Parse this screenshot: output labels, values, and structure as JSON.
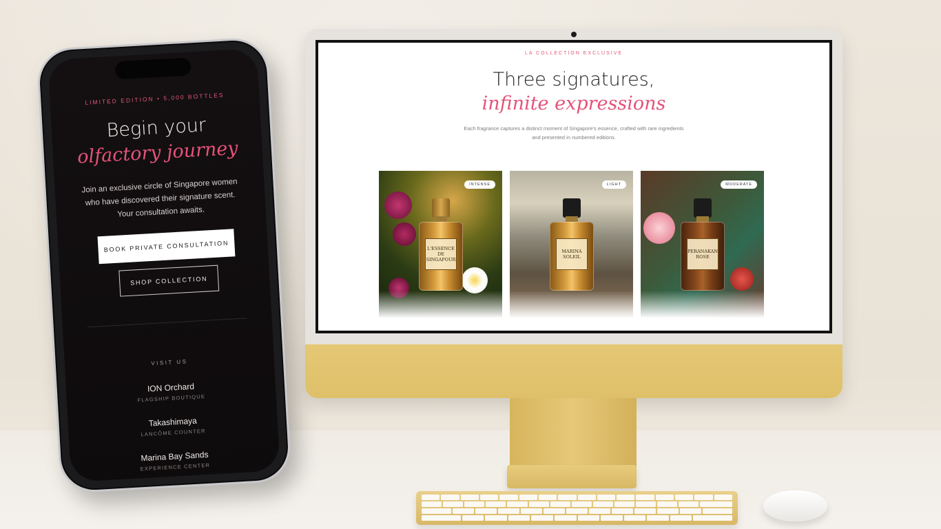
{
  "phone": {
    "eyebrow": "LIMITED EDITION • 5,000 BOTTLES",
    "title_line1": "Begin your",
    "title_line2": "olfactory journey",
    "body": "Join an exclusive circle of Singapore women who have discovered their signature scent. Your consultation awaits.",
    "primary_button": "BOOK PRIVATE CONSULTATION",
    "secondary_button": "SHOP COLLECTION",
    "visit_heading": "VISIT US",
    "locations": [
      {
        "name": "ION Orchard",
        "sub": "FLAGSHIP BOUTIQUE"
      },
      {
        "name": "Takashimaya",
        "sub": "LANCÔME COUNTER"
      },
      {
        "name": "Marina Bay Sands",
        "sub": "EXPERIENCE CENTER"
      }
    ]
  },
  "desktop": {
    "eyebrow": "LA COLLECTION EXCLUSIVE",
    "title_line1": "Three signatures,",
    "title_line2": "infinite expressions",
    "subtitle": "Each fragrance captures a distinct moment of Singapore's essence, crafted with rare ingredients and presented in numbered editions.",
    "products": [
      {
        "badge": "INTENSE",
        "bottle_label": "L'ESSENCE DE SINGAPOUR"
      },
      {
        "badge": "LIGHT",
        "bottle_label": "MARINA SOLEIL"
      },
      {
        "badge": "MODERATE",
        "bottle_label": "PERANAKAN ROSE"
      }
    ]
  },
  "colors": {
    "accent_pink": "#e5527a",
    "phone_bg": "#120e10",
    "imac_gold": "#e2c470"
  }
}
